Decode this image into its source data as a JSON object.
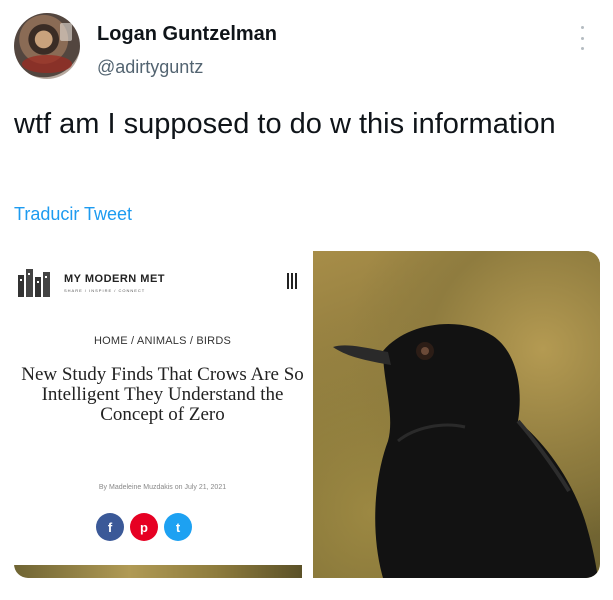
{
  "tweet": {
    "author_name": "Logan Guntzelman",
    "handle": "@adirtyguntz",
    "text": "wtf am I supposed to do w this information",
    "translate_label": "Traducir Tweet"
  },
  "article": {
    "site_name": "MY MODERN MET",
    "site_tagline": "SHARE / INSPIRE / CONNECT",
    "breadcrumb": "HOME / ANIMALS / BIRDS",
    "headline": "New Study Finds That Crows Are So Intelligent They Understand the Concept of Zero",
    "byline": "By Madeleine Muzdakis on July 21, 2021",
    "share_buttons": [
      {
        "icon": "facebook-icon",
        "glyph": "f",
        "color": "#3b5998"
      },
      {
        "icon": "pinterest-icon",
        "glyph": "p",
        "color": "#e60023"
      },
      {
        "icon": "twitter-icon",
        "glyph": "t",
        "color": "#1da1f2"
      }
    ]
  },
  "colors": {
    "link": "#1d9bf0",
    "text": "#0f1419",
    "muted": "#536471"
  }
}
